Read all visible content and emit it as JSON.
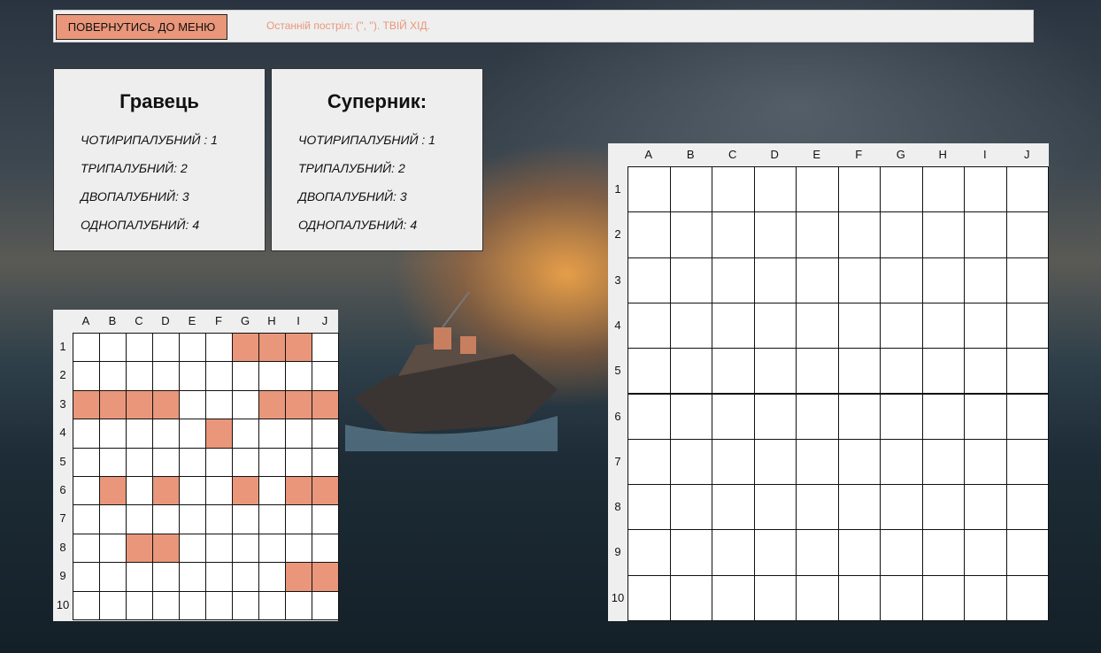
{
  "topbar": {
    "menu_button": "ПОВЕРНУТИСЬ ДО МЕНЮ",
    "status": "Останній постріл: ('', '').  ТВІЙ ХІД."
  },
  "player_panel": {
    "title": "Гравець",
    "lines": [
      "ЧОТИРИПАЛУБНИЙ : 1",
      "ТРИПАЛУБНИЙ: 2",
      "ДВОПАЛУБНИЙ: 3",
      "ОДНОПАЛУБНИЙ: 4"
    ]
  },
  "opponent_panel": {
    "title": "Суперник:",
    "lines": [
      "ЧОТИРИПАЛУБНИЙ : 1",
      "ТРИПАЛУБНИЙ: 2",
      "ДВОПАЛУБНИЙ: 3",
      "ОДНОПАЛУБНИЙ: 4"
    ]
  },
  "columns": [
    "A",
    "B",
    "C",
    "D",
    "E",
    "F",
    "G",
    "H",
    "I",
    "J"
  ],
  "rows": [
    "1",
    "2",
    "3",
    "4",
    "5",
    "6",
    "7",
    "8",
    "9",
    "10"
  ],
  "player_board": {
    "ship_cells": [
      "G1",
      "H1",
      "I1",
      "A3",
      "B3",
      "C3",
      "D3",
      "H3",
      "I3",
      "J3",
      "F4",
      "B6",
      "D6",
      "G6",
      "I6",
      "J6",
      "C8",
      "D8",
      "I9",
      "J9"
    ]
  },
  "opponent_board": {
    "ship_cells": []
  },
  "colors": {
    "accent": "#e9967a",
    "cell": "#ffffff",
    "panel": "#eeeeee"
  }
}
